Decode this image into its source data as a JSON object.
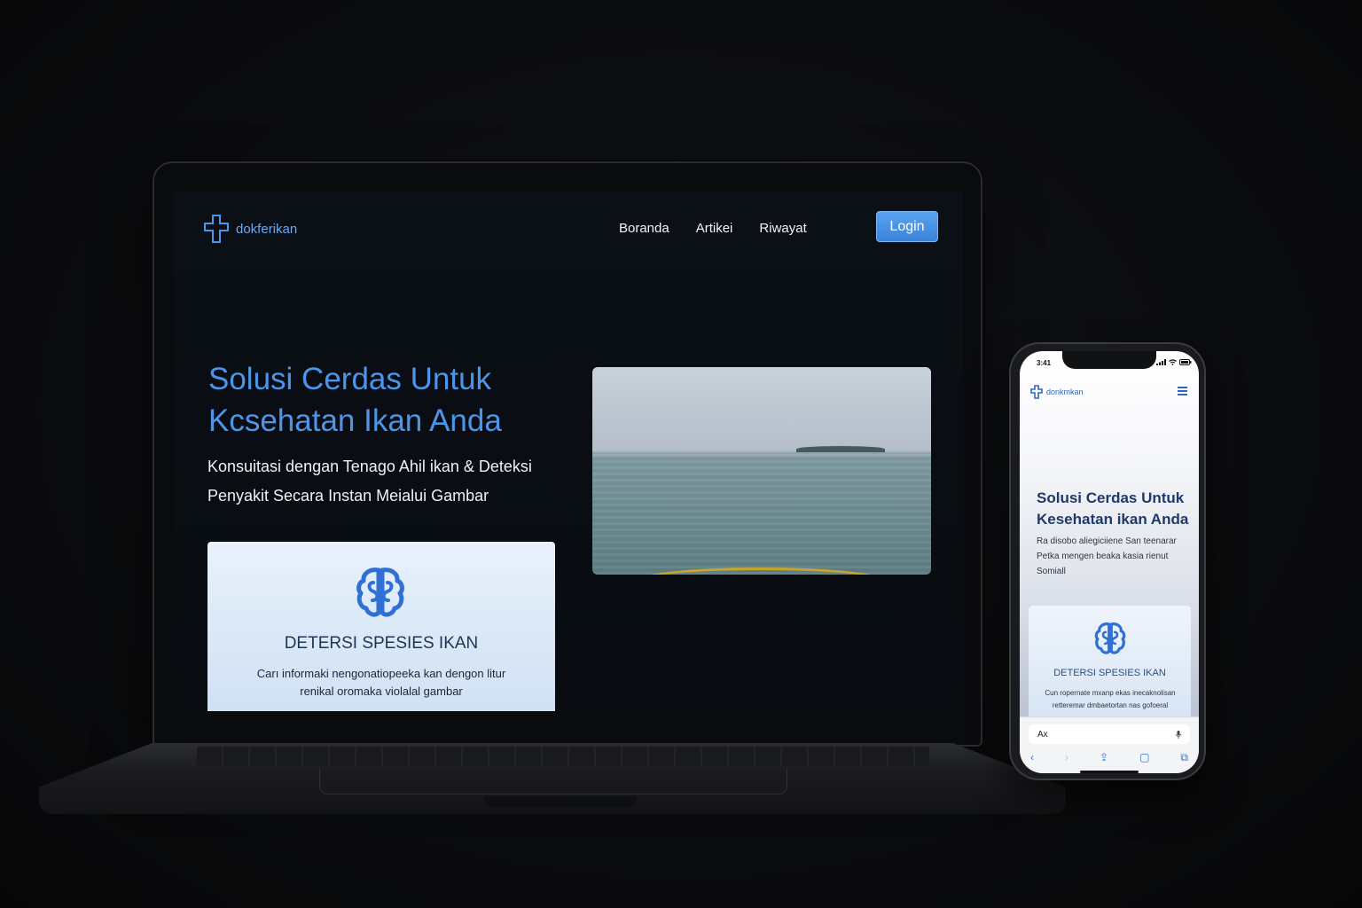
{
  "laptop": {
    "brand": "dokferikan",
    "nav": [
      "Boranda",
      "Artikei",
      "Riwayat"
    ],
    "login_label": "Login",
    "hero_title_line1": "Solusi Cerdas Untuk",
    "hero_title_line2": "Kcsehatan Ikan Anda",
    "hero_subtitle_line1": "Konsuitasi dengan Tenago Ahil ikan & Deteksi",
    "hero_subtitle_line2": "Penyakit Secara Instan Meialui Gambar",
    "card": {
      "title": "DETERSI SPESIES IKAN",
      "desc_line1": "Carı informaki nengonatiopeeka kan dengon litur",
      "desc_line2": "renikal oromaka violalal gambar"
    }
  },
  "phone": {
    "time": "3:41",
    "brand": "donkmkan",
    "hero_title_line1": "Solusi Cerdas Untuk",
    "hero_title_line2": "Kesehatan ikan Anda",
    "desc_line1": "Ra disobo aliegiciiene San teenarar",
    "desc_line2": "Petka mengen beaka kasia rienut",
    "desc_line3": "Somiall",
    "card": {
      "title": "DETERSI SPESIES IKAN",
      "desc_line1": "Cun ropernate mxanp ekas inecaknolisan",
      "desc_line2": "retteremar dmbaetortan nas gofoeral"
    },
    "url_text": "Ax"
  },
  "colors": {
    "accent": "#4d95e8",
    "login_bg": "#3a82d8",
    "phone_title": "#1f3a68"
  }
}
